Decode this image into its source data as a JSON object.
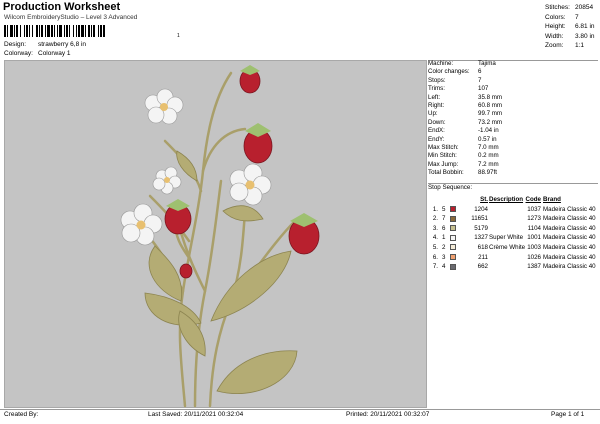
{
  "header": {
    "title": "Production Worksheet",
    "subtitle": "Wilcom EmbroideryStudio – Level 3 Advanced",
    "barcode_number": "1",
    "design_label": "Design:",
    "design_value": "strawberry 6,8 in",
    "colorway_label": "Colorway:",
    "colorway_value": "Colorway 1"
  },
  "stats": [
    {
      "label": "Stitches:",
      "value": "20854"
    },
    {
      "label": "Colors:",
      "value": "7"
    },
    {
      "label": "Height:",
      "value": "6.81 in"
    },
    {
      "label": "Width:",
      "value": "3.80 in"
    },
    {
      "label": "Zoom:",
      "value": "1:1"
    }
  ],
  "info": [
    {
      "label": "Machine:",
      "value": "Tajima"
    },
    {
      "label": "Color changes:",
      "value": "6"
    },
    {
      "label": "Stops:",
      "value": "7"
    },
    {
      "label": "Trims:",
      "value": "107"
    },
    {
      "label": "Left:",
      "value": "35.8 mm"
    },
    {
      "label": "Right:",
      "value": "60.8 mm"
    },
    {
      "label": "Up:",
      "value": "99.7 mm"
    },
    {
      "label": "Down:",
      "value": "73.2 mm"
    },
    {
      "label": "EndX:",
      "value": "-1.04 in"
    },
    {
      "label": "EndY:",
      "value": "0.57 in"
    },
    {
      "label": "Max Stitch:",
      "value": "7.0 mm"
    },
    {
      "label": "Min Stitch:",
      "value": "0.2 mm"
    },
    {
      "label": "Max Jump:",
      "value": "7.2 mm"
    },
    {
      "label": "Total Bobbin:",
      "value": "88.97ft"
    }
  ],
  "stop_sequence": {
    "title": "Stop Sequence:",
    "headers": {
      "st": "St.",
      "description": "Description",
      "code": "Code",
      "brand": "Brand"
    },
    "rows": [
      {
        "no": "1.",
        "stop": "5",
        "color": "#b8202e",
        "st": "1204",
        "description": "",
        "code": "1037",
        "brand": "Madeira Classic 40"
      },
      {
        "no": "2.",
        "stop": "7",
        "color": "#8a6a3a",
        "st": "11651",
        "description": "",
        "code": "1273",
        "brand": "Madeira Classic 40"
      },
      {
        "no": "3.",
        "stop": "6",
        "color": "#c6c090",
        "st": "5179",
        "description": "",
        "code": "1104",
        "brand": "Madeira Classic 40"
      },
      {
        "no": "4.",
        "stop": "1",
        "color": "#f4f4f4",
        "st": "1327",
        "description": "Super White",
        "code": "1001",
        "brand": "Madeira Classic 40"
      },
      {
        "no": "5.",
        "stop": "2",
        "color": "#f3ead6",
        "st": "618",
        "description": "Crème White",
        "code": "1003",
        "brand": "Madeira Classic 40"
      },
      {
        "no": "6.",
        "stop": "3",
        "color": "#f0a070",
        "st": "211",
        "description": "",
        "code": "1026",
        "brand": "Madeira Classic 40"
      },
      {
        "no": "7.",
        "stop": "4",
        "color": "#6a6a70",
        "st": "662",
        "description": "",
        "code": "1387",
        "brand": "Madeira Classic 40"
      }
    ]
  },
  "footer": {
    "created_by": "Created By:",
    "last_saved": "Last Saved: 20/11/2021 00:32:04",
    "printed": "Printed: 20/11/2021 00:32:07",
    "page": "Page 1 of 1"
  }
}
